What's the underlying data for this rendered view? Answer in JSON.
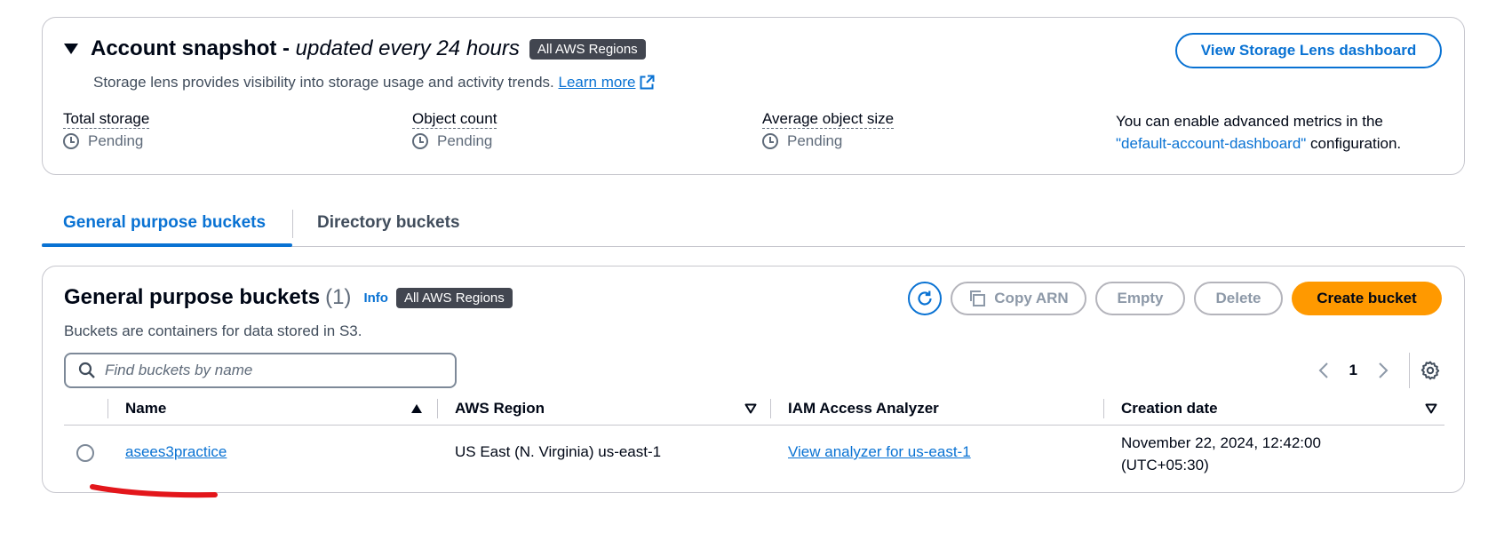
{
  "snapshot": {
    "title_main": "Account snapshot - ",
    "title_sub": "updated every 24 hours",
    "region_badge": "All AWS Regions",
    "description": "Storage lens provides visibility into storage usage and activity trends.",
    "learn_more": "Learn more",
    "dashboard_button": "View Storage Lens dashboard",
    "metrics": [
      {
        "label": "Total storage",
        "value": "Pending"
      },
      {
        "label": "Object count",
        "value": "Pending"
      },
      {
        "label": "Average object size",
        "value": "Pending"
      }
    ],
    "advanced_line1": "You can enable advanced metrics in the",
    "advanced_config": "\"default-account-dashboard\"",
    "advanced_line2_suffix": " configuration."
  },
  "tabs": [
    {
      "label": "General purpose buckets",
      "active": true
    },
    {
      "label": "Directory buckets",
      "active": false
    }
  ],
  "buckets_panel": {
    "title": "General purpose buckets",
    "count": "(1)",
    "info": "Info",
    "region_badge": "All AWS Regions",
    "description": "Buckets are containers for data stored in S3.",
    "buttons": {
      "copy_arn": "Copy ARN",
      "empty": "Empty",
      "delete": "Delete",
      "create": "Create bucket"
    },
    "search": {
      "placeholder": "Find buckets by name",
      "value": ""
    },
    "pagination": {
      "current_page": "1"
    },
    "columns": [
      "Name",
      "AWS Region",
      "IAM Access Analyzer",
      "Creation date"
    ],
    "rows": [
      {
        "name": "asees3practice",
        "region": "US East (N. Virginia) us-east-1",
        "analyzer": "View analyzer for us-east-1",
        "date_line1": "November 22, 2024, 12:42:00",
        "date_line2": "(UTC+05:30)"
      }
    ]
  },
  "colors": {
    "link": "#0972d3",
    "primary_button": "#ff9900",
    "badge": "#424650",
    "annotation": "#e3161b"
  },
  "icons": [
    "caret-down-icon",
    "external-link-icon",
    "clock-icon",
    "refresh-icon",
    "copy-icon",
    "search-icon",
    "chevron-left-icon",
    "chevron-right-icon",
    "settings-gear-icon",
    "sort-ascending-icon",
    "sort-descending-icon"
  ]
}
